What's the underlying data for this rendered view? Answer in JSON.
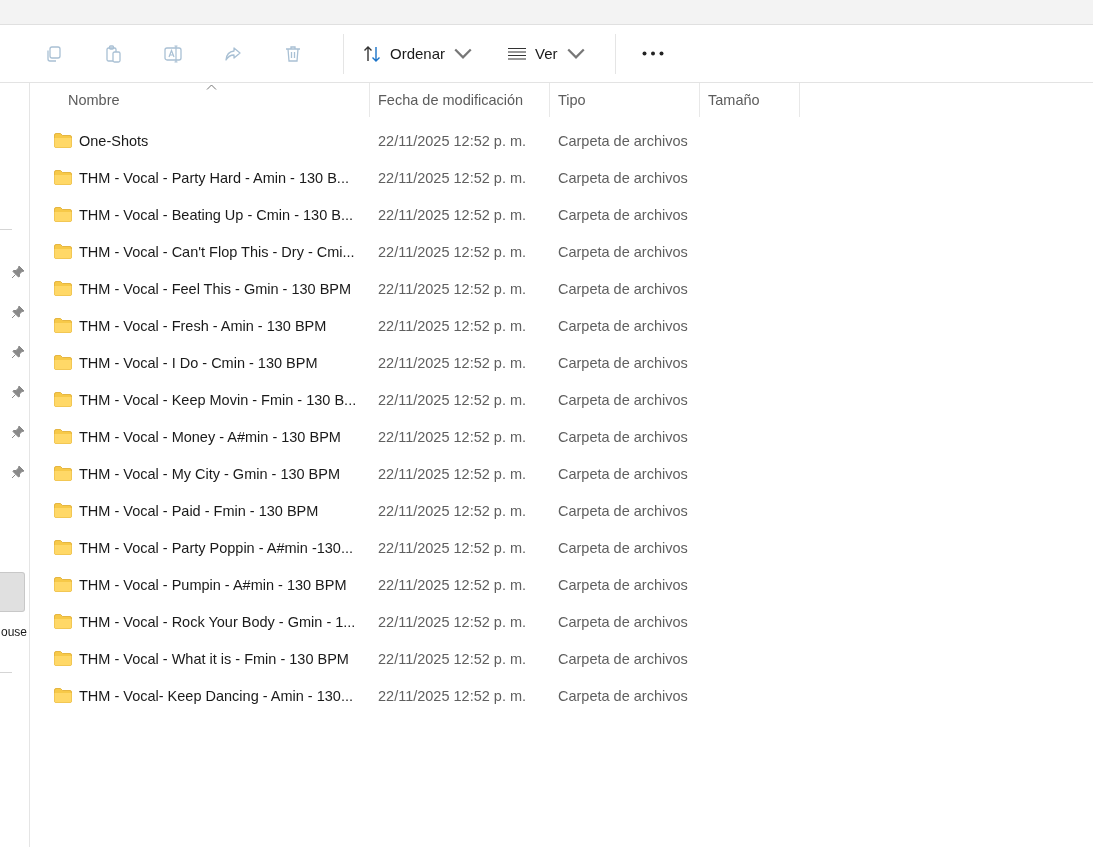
{
  "toolbar": {
    "actions": [
      {
        "kind": "copy",
        "disabled": true
      },
      {
        "kind": "paste",
        "disabled": true
      },
      {
        "kind": "rename",
        "disabled": true
      },
      {
        "kind": "share",
        "disabled": true
      },
      {
        "kind": "delete",
        "disabled": true
      }
    ],
    "sort_button": {
      "label": "Ordenar"
    },
    "view_button": {
      "label": "Ver"
    }
  },
  "sidebar": {
    "quick_access": [
      {
        "pinned": true
      },
      {
        "pinned": true
      },
      {
        "pinned": true
      },
      {
        "pinned": true
      },
      {
        "pinned": true
      },
      {
        "pinned": true
      }
    ],
    "items": [
      {
        "selected": true
      },
      {
        "selected": false,
        "label": "ouse"
      }
    ]
  },
  "table": {
    "columns": [
      {
        "label": "Nombre",
        "sorted": true
      },
      {
        "label": "Fecha de modificación",
        "sorted": false
      },
      {
        "label": "Tipo",
        "sorted": false
      },
      {
        "label": "Tamaño",
        "sorted": false
      }
    ],
    "rows": [
      {
        "name": "One-Shots",
        "modified": "22/11/2025 12:52 p. m.",
        "type": "Carpeta de archivos"
      },
      {
        "name": "THM - Vocal  - Party Hard - Amin - 130 B...",
        "modified": "22/11/2025 12:52 p. m.",
        "type": "Carpeta de archivos"
      },
      {
        "name": "THM - Vocal - Beating Up - Cmin - 130 B...",
        "modified": "22/11/2025 12:52 p. m.",
        "type": "Carpeta de archivos"
      },
      {
        "name": "THM - Vocal - Can't Flop This - Dry - Cmi...",
        "modified": "22/11/2025 12:52 p. m.",
        "type": "Carpeta de archivos"
      },
      {
        "name": "THM - Vocal - Feel This - Gmin - 130 BPM",
        "modified": "22/11/2025 12:52 p. m.",
        "type": "Carpeta de archivos"
      },
      {
        "name": "THM - Vocal - Fresh - Amin - 130 BPM",
        "modified": "22/11/2025 12:52 p. m.",
        "type": "Carpeta de archivos"
      },
      {
        "name": "THM - Vocal - I Do - Cmin - 130 BPM",
        "modified": "22/11/2025 12:52 p. m.",
        "type": "Carpeta de archivos"
      },
      {
        "name": "THM - Vocal - Keep Movin - Fmin - 130 B...",
        "modified": "22/11/2025 12:52 p. m.",
        "type": "Carpeta de archivos"
      },
      {
        "name": "THM - Vocal - Money - A#min - 130 BPM",
        "modified": "22/11/2025 12:52 p. m.",
        "type": "Carpeta de archivos"
      },
      {
        "name": "THM - Vocal - My City - Gmin - 130 BPM",
        "modified": "22/11/2025 12:52 p. m.",
        "type": "Carpeta de archivos"
      },
      {
        "name": "THM - Vocal - Paid - Fmin - 130 BPM",
        "modified": "22/11/2025 12:52 p. m.",
        "type": "Carpeta de archivos"
      },
      {
        "name": "THM - Vocal - Party Poppin - A#min -130...",
        "modified": "22/11/2025 12:52 p. m.",
        "type": "Carpeta de archivos"
      },
      {
        "name": "THM - Vocal - Pumpin - A#min - 130 BPM",
        "modified": "22/11/2025 12:52 p. m.",
        "type": "Carpeta de archivos"
      },
      {
        "name": "THM - Vocal - Rock Your Body - Gmin - 1...",
        "modified": "22/11/2025 12:52 p. m.",
        "type": "Carpeta de archivos"
      },
      {
        "name": "THM - Vocal - What it is - Fmin - 130 BPM",
        "modified": "22/11/2025 12:52 p. m.",
        "type": "Carpeta de archivos"
      },
      {
        "name": "THM - Vocal- Keep Dancing - Amin - 130...",
        "modified": "22/11/2025 12:52 p. m.",
        "type": "Carpeta de archivos"
      }
    ]
  }
}
